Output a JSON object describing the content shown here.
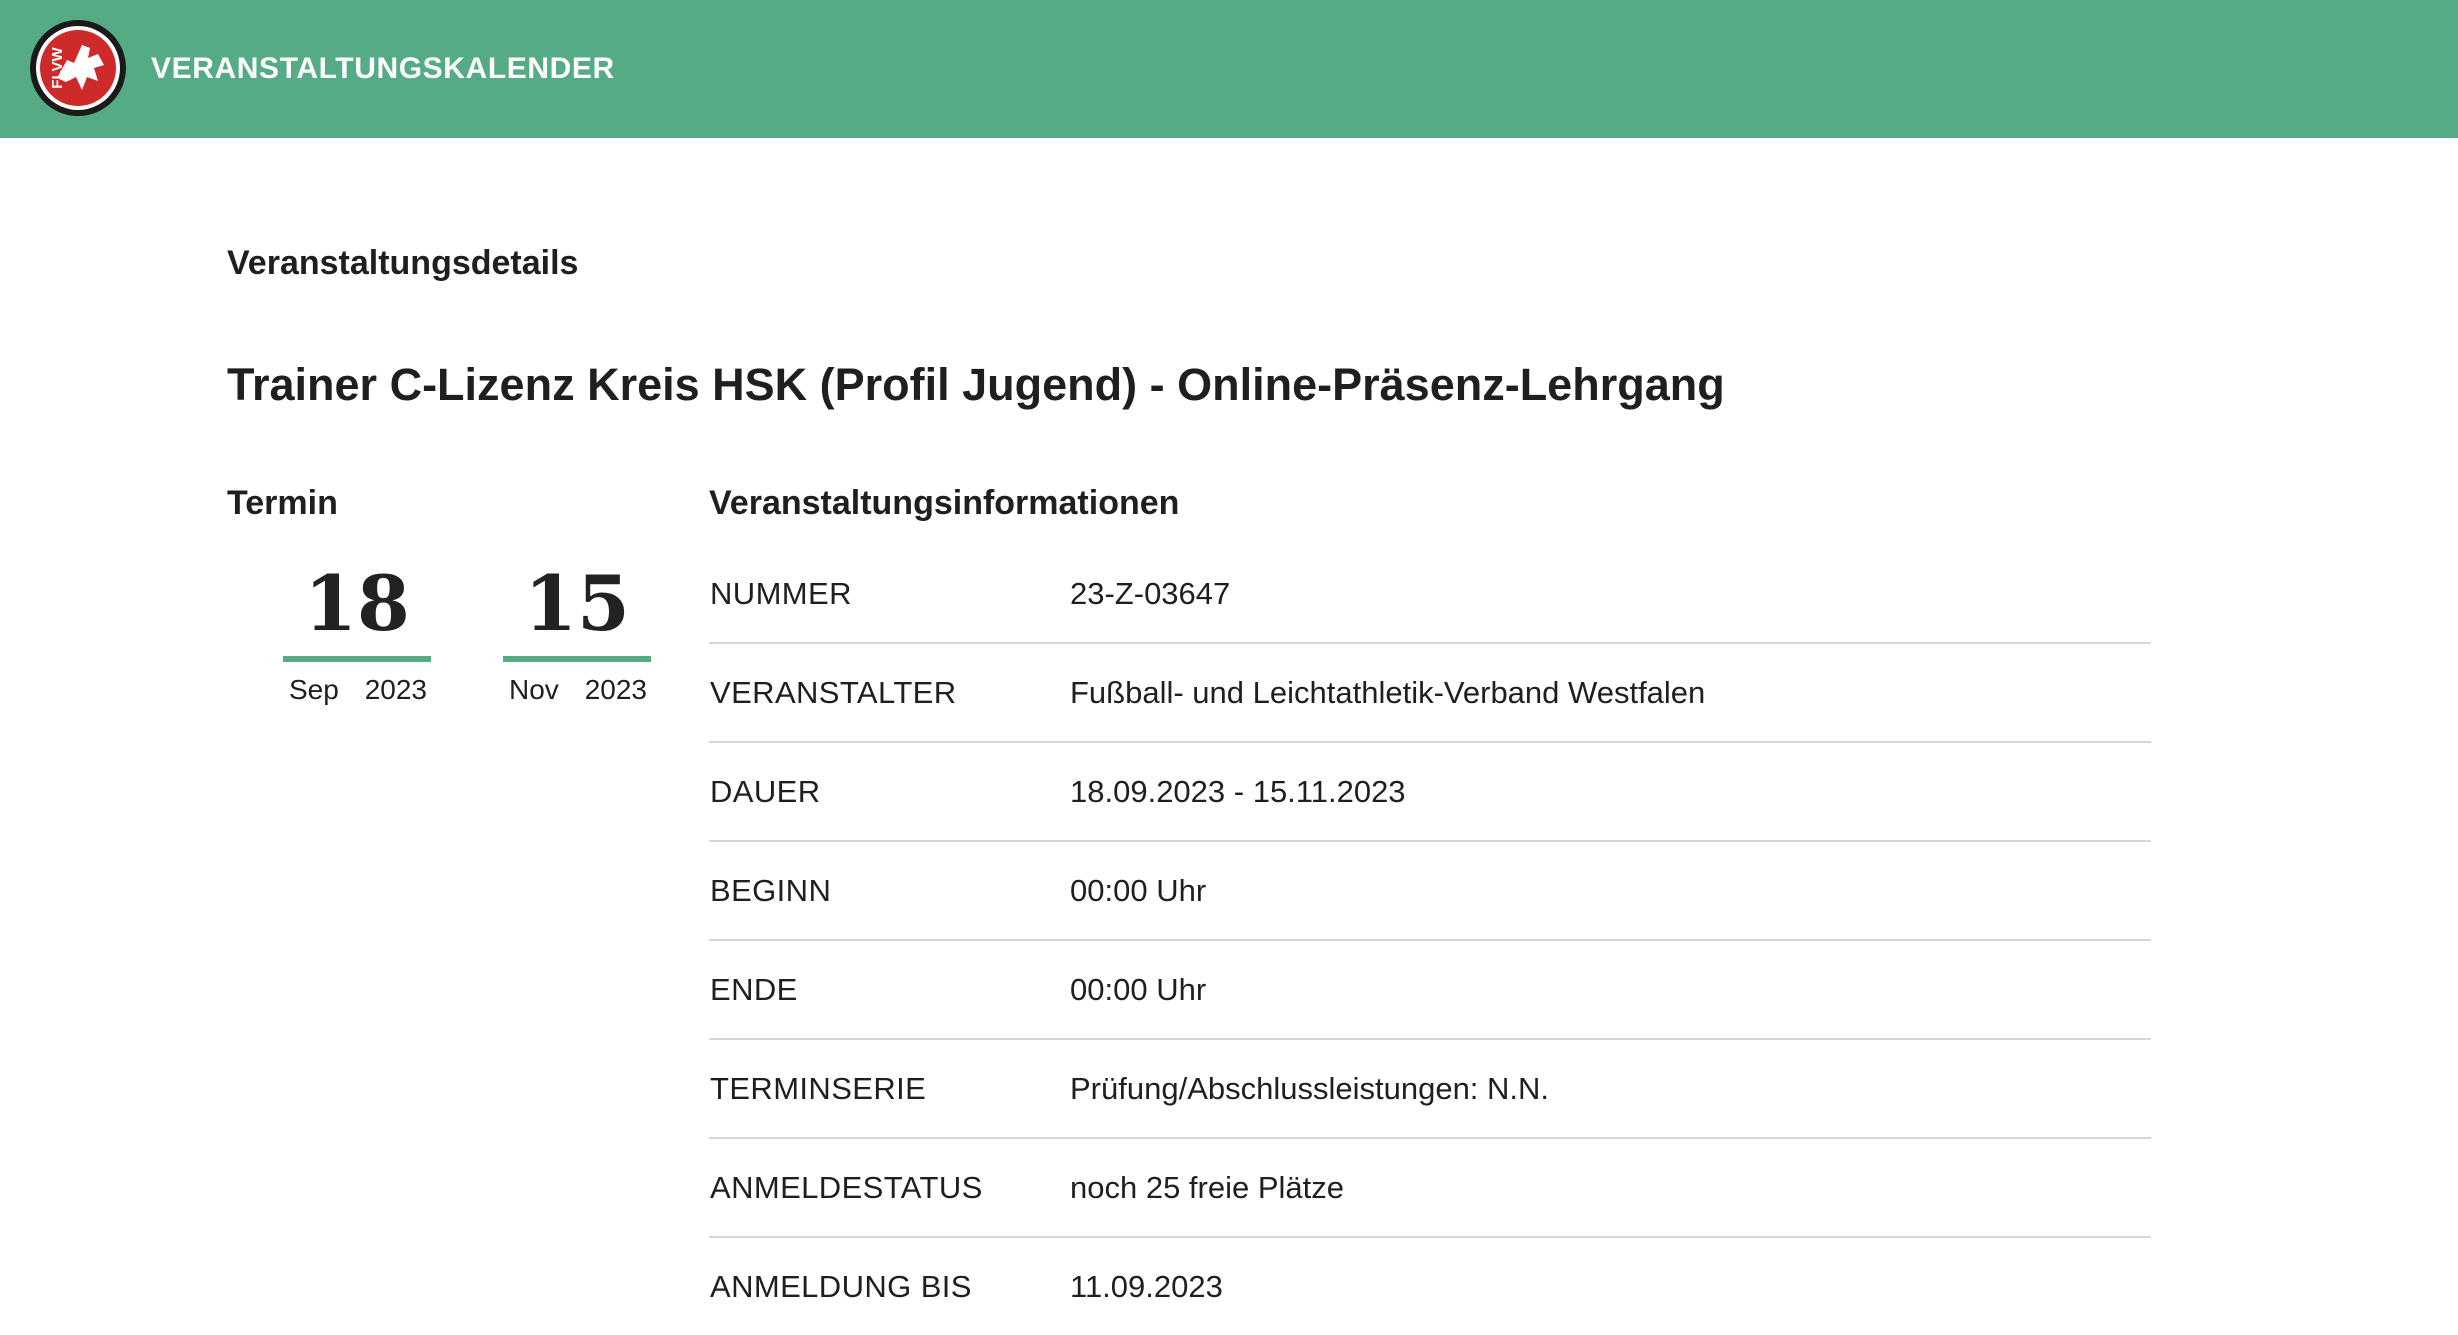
{
  "header": {
    "logo_text": "FLVW",
    "title": "VERANSTALTUNGSKALENDER",
    "background_color": "#55ab84"
  },
  "page": {
    "section_title": "Veranstaltungsdetails",
    "event_title": "Trainer C-Lizenz Kreis HSK (Profil Jugend) - Online-Präsenz-Lehrgang"
  },
  "termin": {
    "heading": "Termin",
    "start": {
      "day": "18",
      "month": "Sep",
      "year": "2023"
    },
    "end": {
      "day": "15",
      "month": "Nov",
      "year": "2023"
    },
    "accent_color": "#55ab84"
  },
  "info": {
    "heading": "Veranstaltungsinformationen",
    "rows": [
      {
        "label": "NUMMER",
        "value": "23-Z-03647"
      },
      {
        "label": "VERANSTALTER",
        "value": "Fußball- und Leichtathletik-Verband Westfalen"
      },
      {
        "label": "DAUER",
        "value": "18.09.2023 - 15.11.2023"
      },
      {
        "label": "BEGINN",
        "value": "00:00 Uhr"
      },
      {
        "label": "ENDE",
        "value": "00:00 Uhr"
      },
      {
        "label": "TERMINSERIE",
        "value": "Prüfung/Abschlussleistungen: N.N."
      },
      {
        "label": "ANMELDESTATUS",
        "value": "noch 25 freie Plätze"
      },
      {
        "label": "ANMELDUNG BIS",
        "value": "11.09.2023"
      }
    ]
  }
}
